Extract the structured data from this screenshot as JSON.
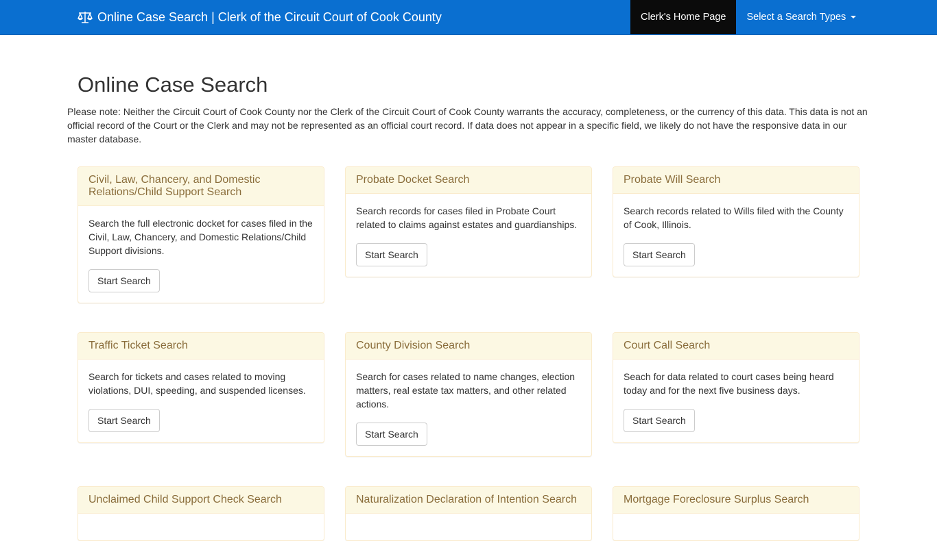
{
  "navbar": {
    "brand_icon": "balance-scale-icon",
    "brand_title": "Online Case Search | Clerk of the Circuit Court of Cook County",
    "home_link": "Clerk's Home Page",
    "search_types_dropdown": "Select a Search Types",
    "bg_color": "#0a6fd0"
  },
  "page": {
    "title": "Online Case Search",
    "note": "Please note: Neither the Circuit Court of Cook County nor the Clerk of the Circuit Court of Cook County warrants the accuracy, completeness, or the currency of this data. This data is not an official record of the Court or the Clerk and may not be represented as an official court record. If data does not appear in a specific field, we likely do not have the responsive data in our master database."
  },
  "cards": [
    {
      "title": "Civil, Law, Chancery, and Domestic Relations/Child Support Search",
      "text": "Search the full electronic docket for cases filed in the Civil, Law, Chancery, and Domestic Relations/Child Support divisions.",
      "button": "Start Search"
    },
    {
      "title": "Probate Docket Search",
      "text": "Search records for cases filed in Probate Court related to claims against estates and guardianships.",
      "button": "Start Search"
    },
    {
      "title": "Probate Will Search",
      "text": "Search records related to Wills filed with the County of Cook, Illinois.",
      "button": "Start Search"
    },
    {
      "title": "Traffic Ticket Search",
      "text": "Search for tickets and cases related to moving violations, DUI, speeding, and suspended licenses.",
      "button": "Start Search"
    },
    {
      "title": "County Division Search",
      "text": "Search for cases related to name changes, election matters, real estate tax matters, and other related actions.",
      "button": "Start Search"
    },
    {
      "title": "Court Call Search",
      "text": "Seach for data related to court cases being heard today and for the next five business days.",
      "button": "Start Search"
    },
    {
      "title": "Unclaimed Child Support Check Search",
      "text": "",
      "button": ""
    },
    {
      "title": "Naturalization Declaration of Intention Search",
      "text": "",
      "button": ""
    },
    {
      "title": "Mortgage Foreclosure Surplus Search",
      "text": "",
      "button": ""
    }
  ]
}
